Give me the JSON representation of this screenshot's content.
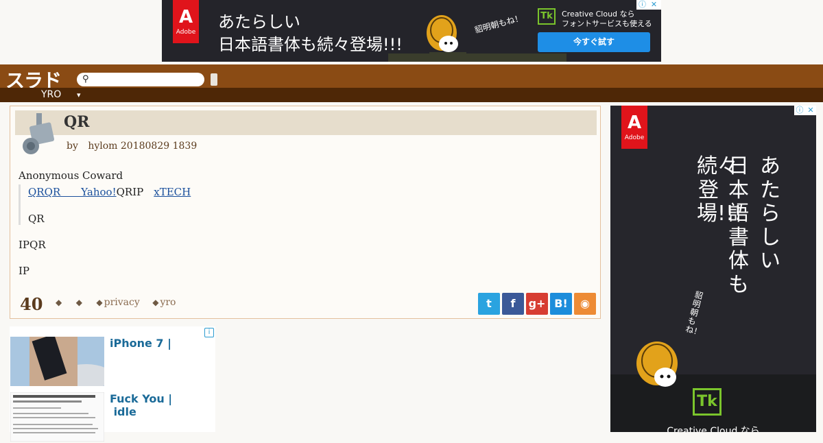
{
  "top_ad": {
    "brand": "A",
    "brand_name": "Adobe",
    "headline1": "あたらしい",
    "headline2": "日本語書体も続々登場!!!",
    "vertical_text": "貂明朝もね！",
    "tk": "Tk",
    "cc_line1": "Creative Cloud なら",
    "cc_line2": "フォントサービスも使える",
    "cta": "今すぐ試す",
    "info_icon": "ⓘ",
    "close_icon": "✕"
  },
  "header": {
    "logo": "スラド",
    "search_icon": "🔍",
    "search_placeholder": "",
    "section": "YRO",
    "caret": "▾"
  },
  "article": {
    "title": "QR",
    "by": "by",
    "author_date": "hylom 20180829 1839",
    "submitter": "Anonymous Coward",
    "quote_link1": "QRQR　　Yahoo!",
    "quote_text1": "QRIP　",
    "quote_link2": "xTECH",
    "quote_text2": "QR",
    "para1": "IPQR",
    "para2": "IP",
    "comment_count": "40",
    "tags": [
      {
        "label": ""
      },
      {
        "label": ""
      },
      {
        "label": "privacy"
      },
      {
        "label": "yro"
      }
    ],
    "tag_icon": "◆",
    "share": {
      "twitter": "t",
      "facebook": "f",
      "googleplus": "g+",
      "hatena": "B!",
      "rss": "◉"
    }
  },
  "related": {
    "info": "i",
    "items": [
      {
        "title": "iPhone 7 |"
      },
      {
        "title": "Fuck You |\n idle"
      }
    ]
  },
  "side_ad": {
    "brand": "A",
    "brand_name": "Adobe",
    "col1": "あたらしい",
    "col2": "日本語書体も",
    "col3": "続々登場!!!",
    "vertical_small": "貂明朝もね！",
    "tk": "Tk",
    "cc": "Creative Cloud なら",
    "info_icon": "ⓘ",
    "close_icon": "✕"
  },
  "colors": {
    "header_brown": "#8a4b14",
    "subnav_brown": "#4e2706",
    "title_bar": "#e6ddcc",
    "link_blue": "#1a4f9c"
  }
}
